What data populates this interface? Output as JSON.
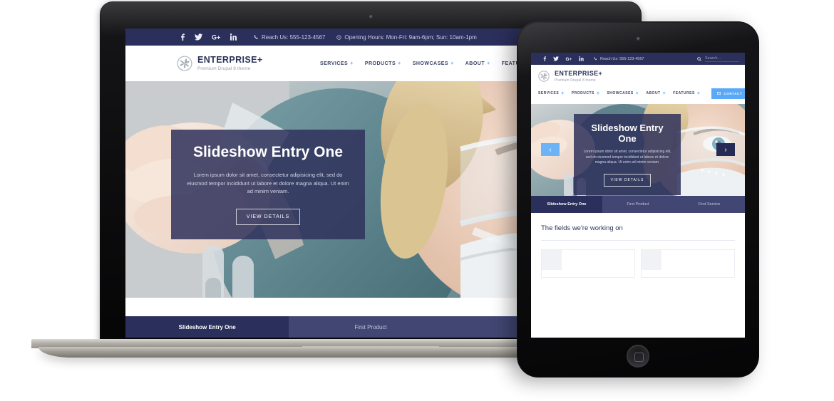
{
  "topbar": {
    "socials": [
      {
        "name": "facebook-icon",
        "glyph": "f"
      },
      {
        "name": "twitter-icon",
        "glyph": "✉"
      },
      {
        "name": "google-plus-icon",
        "glyph": "G+"
      },
      {
        "name": "linkedin-icon",
        "glyph": "in"
      }
    ],
    "phone": "Reach Us: 555-123-4567",
    "hours": "Opening Hours: Mon-Fri: 9am-6pm; Sun: 10am-1pm",
    "search_placeholder": "Search...",
    "bg_color": "#2b2f5c"
  },
  "brand": {
    "name": "ENTERPRISE+",
    "tagline": "Premium Drupal 8 theme"
  },
  "nav": {
    "items": [
      {
        "label": "SERVICES",
        "marker": "+"
      },
      {
        "label": "PRODUCTS",
        "marker": "+"
      },
      {
        "label": "SHOWCASES",
        "marker": "+"
      },
      {
        "label": "ABOUT",
        "marker": "+"
      },
      {
        "label": "FEATURES",
        "marker": "+"
      }
    ],
    "contact_label": "CONTACT",
    "accent_color": "#5aa9f8"
  },
  "hero": {
    "title": "Slideshow Entry One",
    "description": "Lorem ipsum dolor sit amet, consectetur adipisicing elit, sed do eiusmod tempor incididunt ut labore et dolore magna aliqua. Ut enim ad minim veniam.",
    "button_label": "VIEW DETAILS",
    "prev_arrow": "‹",
    "next_arrow": "›",
    "overlay_color": "#30325c"
  },
  "tabs": [
    {
      "label": "Slideshow Entry One",
      "active": true
    },
    {
      "label": "First Product",
      "active": false
    },
    {
      "label": "First Service",
      "active": false
    }
  ],
  "fields_section": {
    "heading": "The fields we're working on"
  }
}
